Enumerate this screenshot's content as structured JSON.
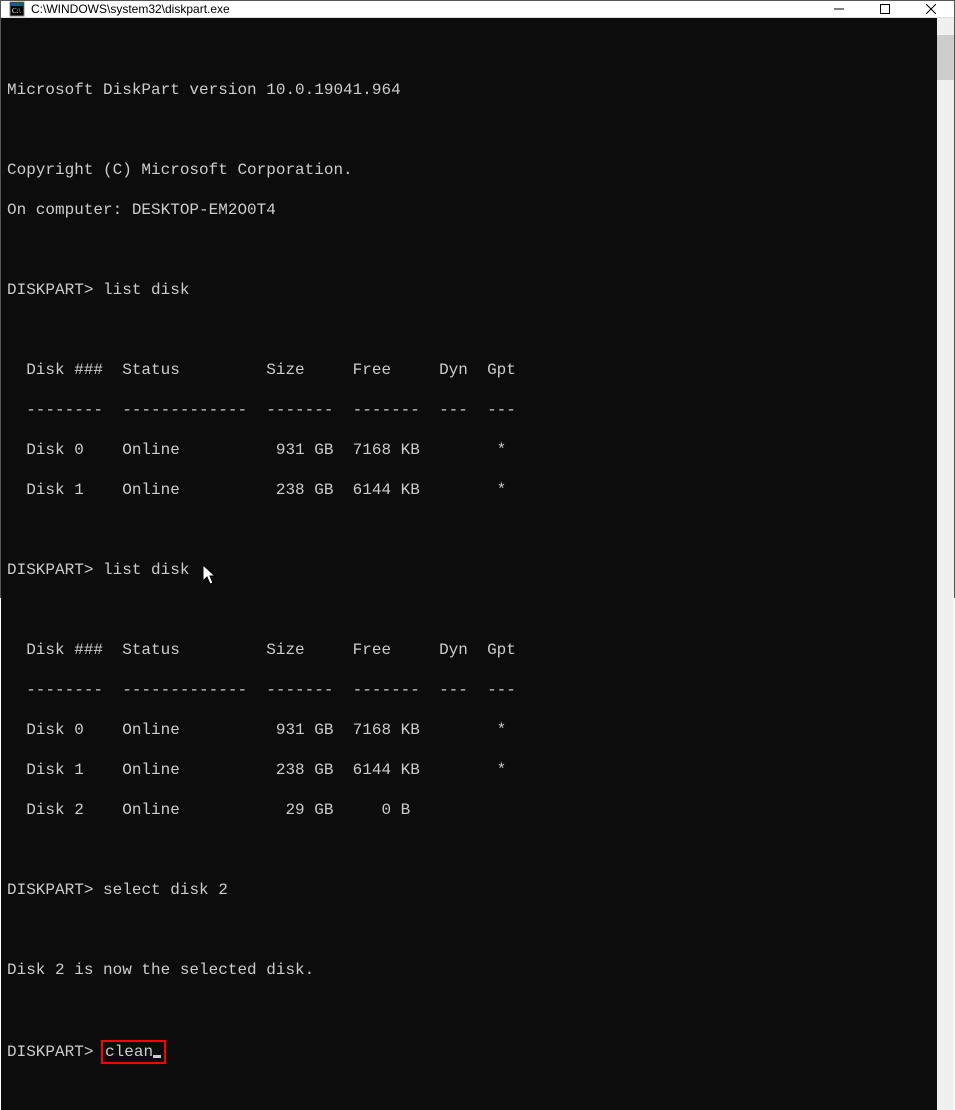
{
  "window": {
    "title": "C:\\WINDOWS\\system32\\diskpart.exe"
  },
  "terminal": {
    "header_version": "Microsoft DiskPart version 10.0.19041.964",
    "copyright": "Copyright (C) Microsoft Corporation.",
    "computer": "On computer: DESKTOP-EM2O0T4",
    "prompt": "DISKPART>",
    "cmd1": "list disk",
    "table1_head": "  Disk ###  Status         Size     Free     Dyn  Gpt",
    "table1_div": "  --------  -------------  -------  -------  ---  ---",
    "table1_r0": "  Disk 0    Online          931 GB  7168 KB        *",
    "table1_r1": "  Disk 1    Online          238 GB  6144 KB        *",
    "cmd2": "list disk",
    "table2_head": "  Disk ###  Status         Size     Free     Dyn  Gpt",
    "table2_div": "  --------  -------------  -------  -------  ---  ---",
    "table2_r0": "  Disk 0    Online          931 GB  7168 KB        *",
    "table2_r1": "  Disk 1    Online          238 GB  6144 KB        *",
    "table2_r2": "  Disk 2    Online           29 GB     0 B",
    "cmd3": "select disk 2",
    "result_select": "Disk 2 is now the selected disk.",
    "cmd4": "clean"
  }
}
